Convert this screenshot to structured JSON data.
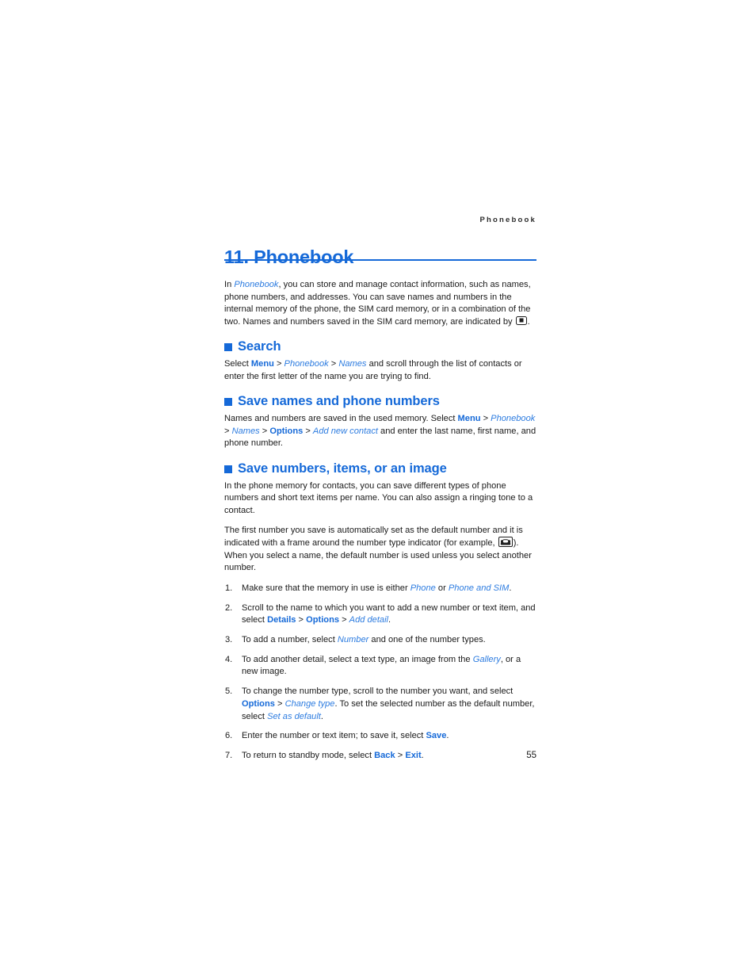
{
  "document": {
    "running_header": "Phonebook",
    "chapter_title": "11. Phonebook",
    "page_number": "55",
    "accent_color": "#1569d8",
    "text_color": "#1a1a1a"
  },
  "intro": {
    "part1": "In ",
    "phonebook": "Phonebook",
    "part2": ", you can store and manage contact information, such as names, phone numbers, and addresses. You can save names and numbers in the internal memory of the phone, the SIM card memory, or in a combination of the two. Names and numbers saved in the SIM card memory, are indicated by ",
    "part3": ".",
    "sim_icon": "sim-card-icon"
  },
  "sections": [
    {
      "heading": "Search",
      "body": {
        "p1a": "Select ",
        "menu": "Menu",
        "sep1": " > ",
        "phonebook": "Phonebook",
        "sep2": " > ",
        "names": "Names",
        "p1b": " and scroll through the list of contacts or enter the first letter of the name you are trying to find."
      }
    },
    {
      "heading": "Save names and phone numbers",
      "body": {
        "p1a": "Names and numbers are saved in the used memory. Select ",
        "menu": "Menu",
        "sep1": " > ",
        "phonebook": "Phonebook",
        "sep2": " > ",
        "names": "Names",
        "sep3": " > ",
        "options": "Options",
        "sep4": " > ",
        "add_new_contact": "Add new contact",
        "p1b": " and enter the last name, first name, and phone number."
      }
    },
    {
      "heading": "Save numbers, items, or an image",
      "body": {
        "p1": "In the phone memory for contacts, you can save different types of phone numbers and short text items per name. You can also assign a ringing tone to a contact.",
        "p2a": "The first number you save is automatically set as the default number and it is indicated with a frame around the number type indicator (for example, ",
        "p2b": "). When you select a name, the default number is used unless you select another number.",
        "default_number_icon": "default-phone-number-icon"
      },
      "steps": [
        {
          "a": "Make sure that the memory in use is either ",
          "i1": "Phone",
          "b": " or ",
          "i2": "Phone and SIM",
          "c": "."
        },
        {
          "a": "Scroll to the name to which you want to add a new number or text item, and select ",
          "u1": "Details",
          "s1": " > ",
          "u2": "Options",
          "s2": " > ",
          "i1": "Add detail",
          "c": "."
        },
        {
          "a": "To add a number, select ",
          "i1": "Number",
          "b": " and one of the number types."
        },
        {
          "a": "To add another detail, select a text type, an image from the ",
          "i1": "Gallery",
          "b": ", or a new image."
        },
        {
          "a": "To change the number type, scroll to the number you want, and select ",
          "u1": "Options",
          "s1": " > ",
          "i1": "Change type",
          "b": ". To set the selected number as the default number, select ",
          "i2": "Set as default",
          "c": "."
        },
        {
          "a": "Enter the number or text item; to save it, select ",
          "u1": "Save",
          "c": "."
        },
        {
          "a": "To return to standby mode, select ",
          "u1": "Back",
          "s1": " > ",
          "u2": "Exit",
          "c": "."
        }
      ]
    }
  ]
}
